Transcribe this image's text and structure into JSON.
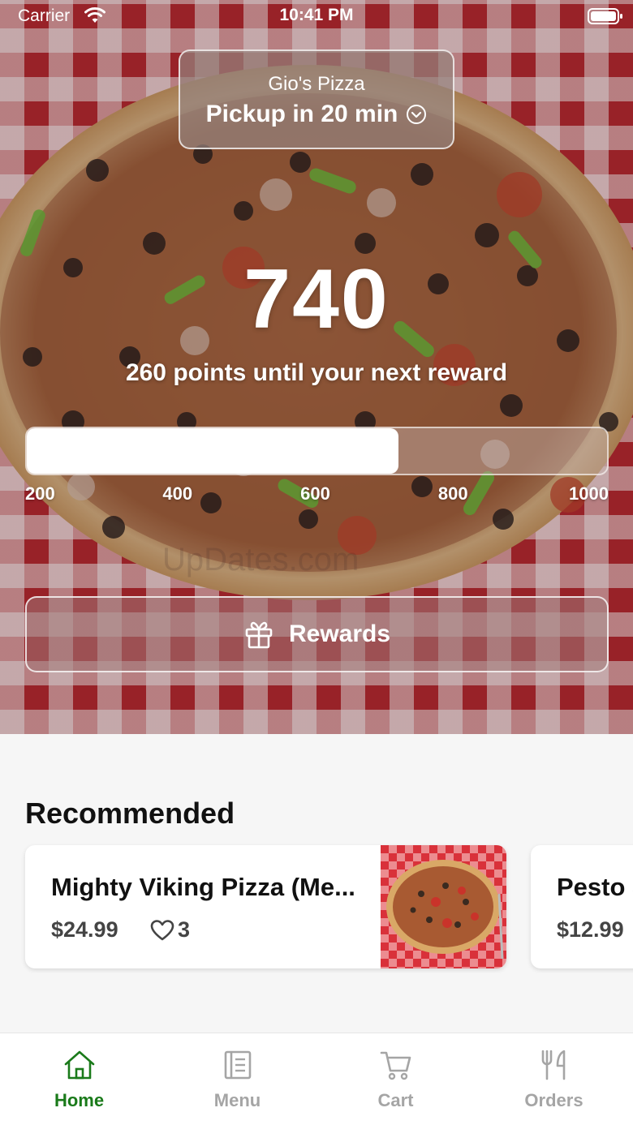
{
  "status_bar": {
    "carrier": "Carrier",
    "time": "10:41 PM"
  },
  "location": {
    "store_name": "Gio's Pizza",
    "pickup": "Pickup in 20 min"
  },
  "rewards": {
    "points": "740",
    "subtitle": "260 points until your next reward",
    "progress_fraction": 0.64,
    "ticks": [
      "200",
      "400",
      "600",
      "800",
      "1000"
    ],
    "button_label": "Rewards"
  },
  "watermark": "UpDates.com",
  "recommended": {
    "title": "Recommended",
    "items": [
      {
        "name": "Mighty Viking Pizza (Me...",
        "price": "$24.99",
        "likes": "3"
      },
      {
        "name": "Pesto S",
        "price": "$12.99"
      }
    ]
  },
  "tabs": [
    {
      "label": "Home",
      "icon": "home-icon",
      "active": true
    },
    {
      "label": "Menu",
      "icon": "menu-icon",
      "active": false
    },
    {
      "label": "Cart",
      "icon": "cart-icon",
      "active": false
    },
    {
      "label": "Orders",
      "icon": "orders-icon",
      "active": false
    }
  ],
  "colors": {
    "accent": "#1a7a1a",
    "inactive_tab": "#a5a5a5",
    "tablecloth_red": "#b8272f"
  }
}
